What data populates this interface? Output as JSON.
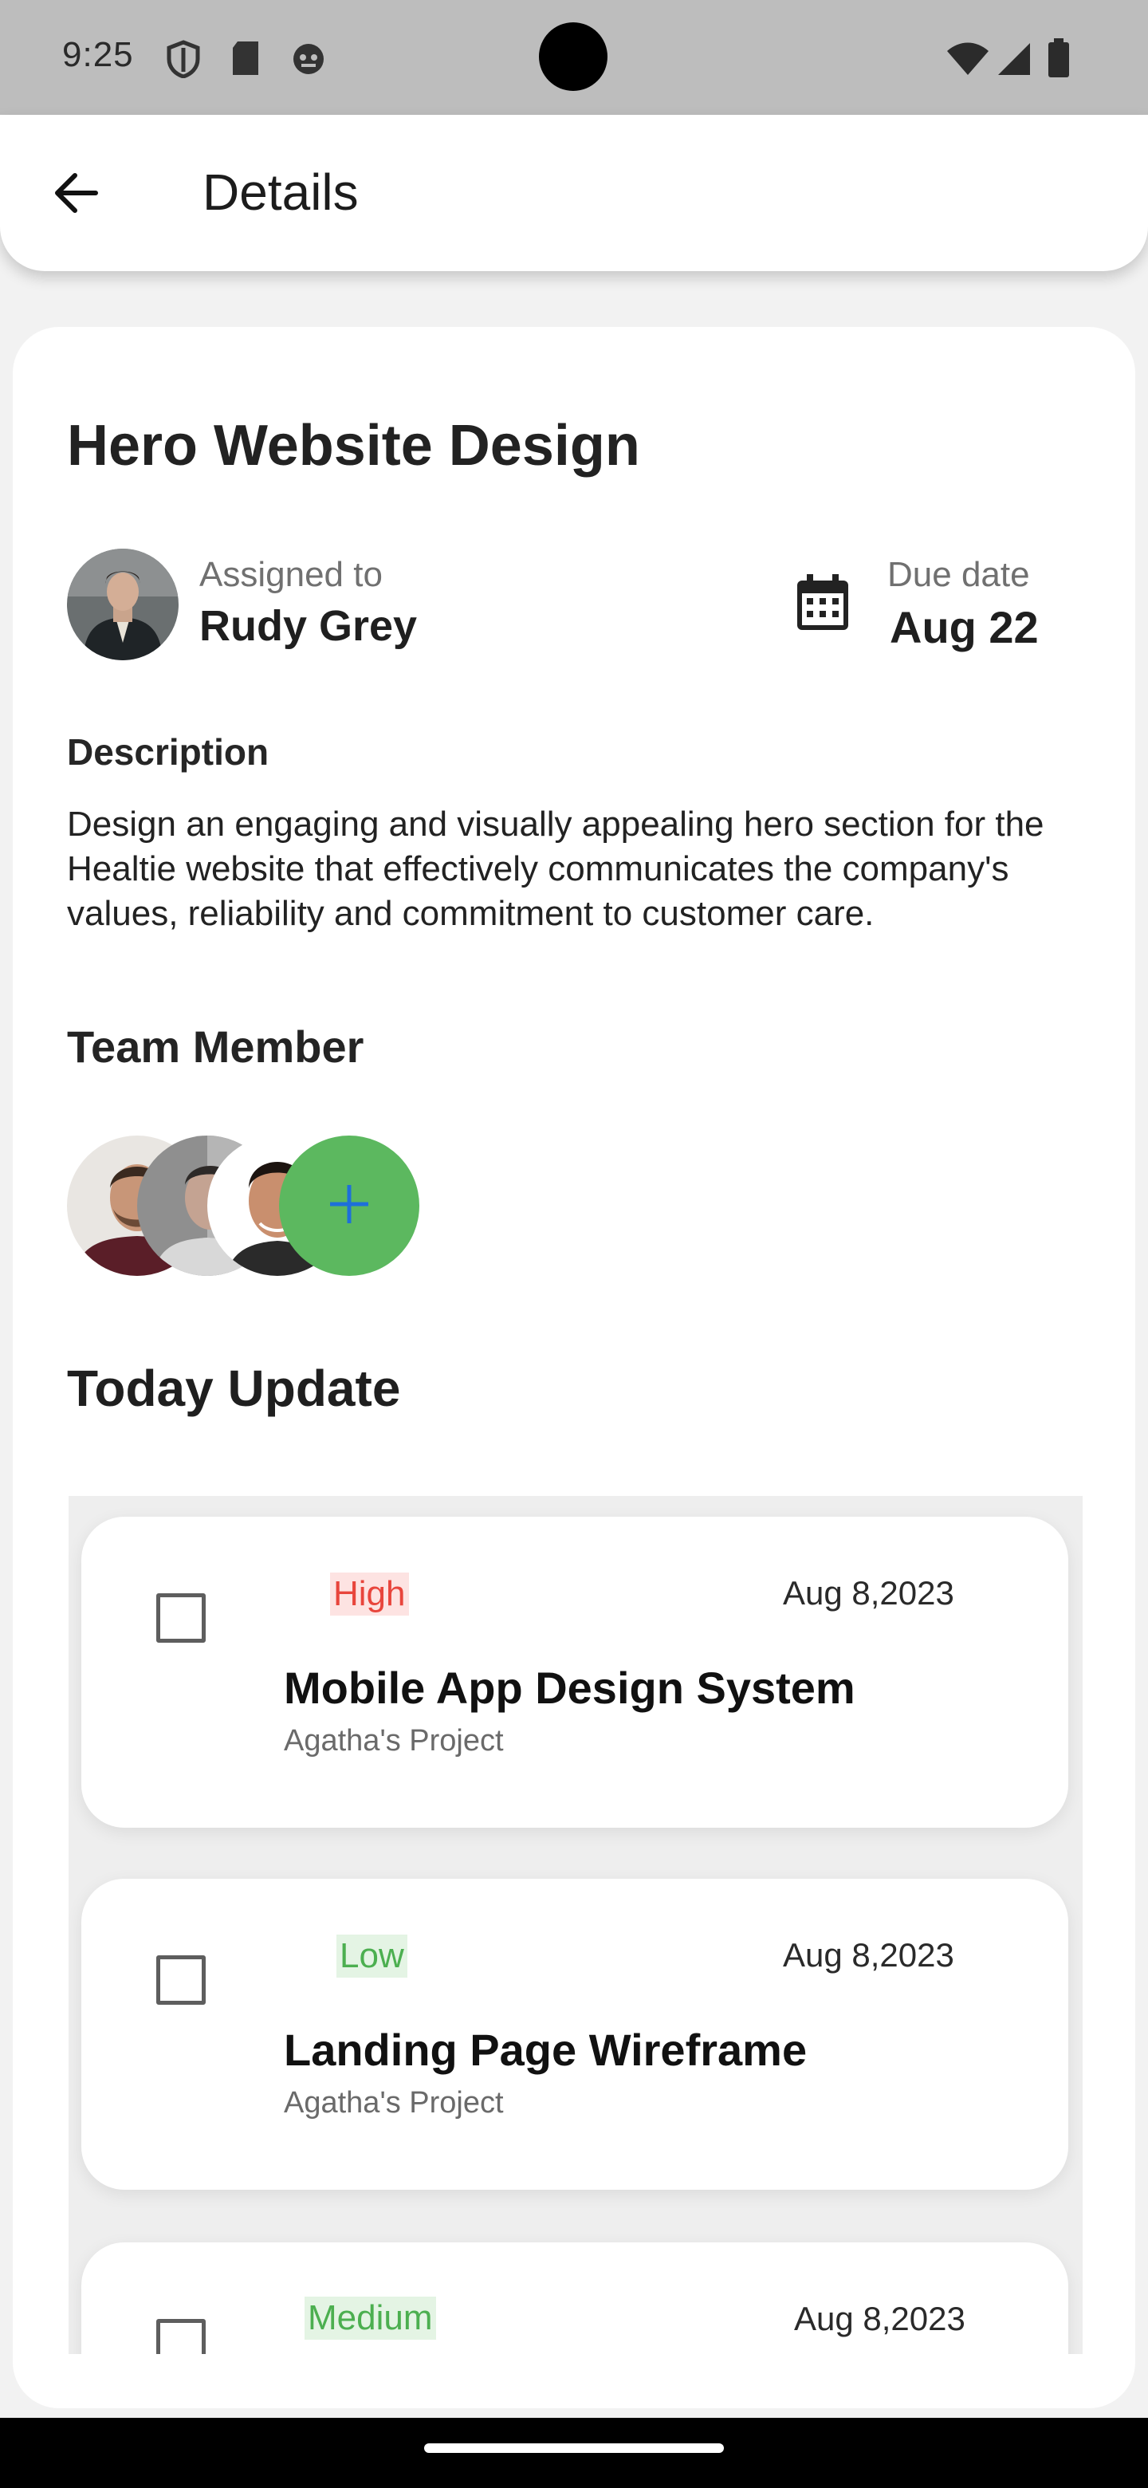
{
  "status_bar": {
    "time": "9:25",
    "left_icons": [
      "shield-icon",
      "sd-card-icon",
      "robot-icon"
    ],
    "right_icons": [
      "wifi-icon",
      "signal-icon",
      "battery-icon"
    ]
  },
  "app_bar": {
    "back_icon": "arrow-left-icon",
    "title": "Details"
  },
  "task": {
    "title": "Hero Website Design",
    "assigned_label": "Assigned to",
    "assignee": "Rudy Grey",
    "due_label": "Due date",
    "due_date": "Aug 22",
    "description_label": "Description",
    "description": "Design an engaging and visually appealing hero section for the Healtie website that effectively communicates the company's values, reliability and commitment to customer care."
  },
  "team": {
    "label": "Team Member",
    "add_icon": "plus-icon"
  },
  "today": {
    "label": "Today Update",
    "items": [
      {
        "priority": "High",
        "date": "Aug 8,2023",
        "title": "Mobile App Design System",
        "project": "Agatha's Project"
      },
      {
        "priority": "Low",
        "date": "Aug 8,2023",
        "title": "Landing Page Wireframe",
        "project": "Agatha's Project"
      },
      {
        "priority": "Medium",
        "date": "Aug 8,2023",
        "title": "",
        "project": ""
      }
    ]
  },
  "colors": {
    "priority_high": "#e8453c",
    "priority_low": "#4caf50",
    "priority_medium": "#4caf50",
    "add_button": "#5cb85f",
    "add_icon": "#1e6fd9"
  }
}
